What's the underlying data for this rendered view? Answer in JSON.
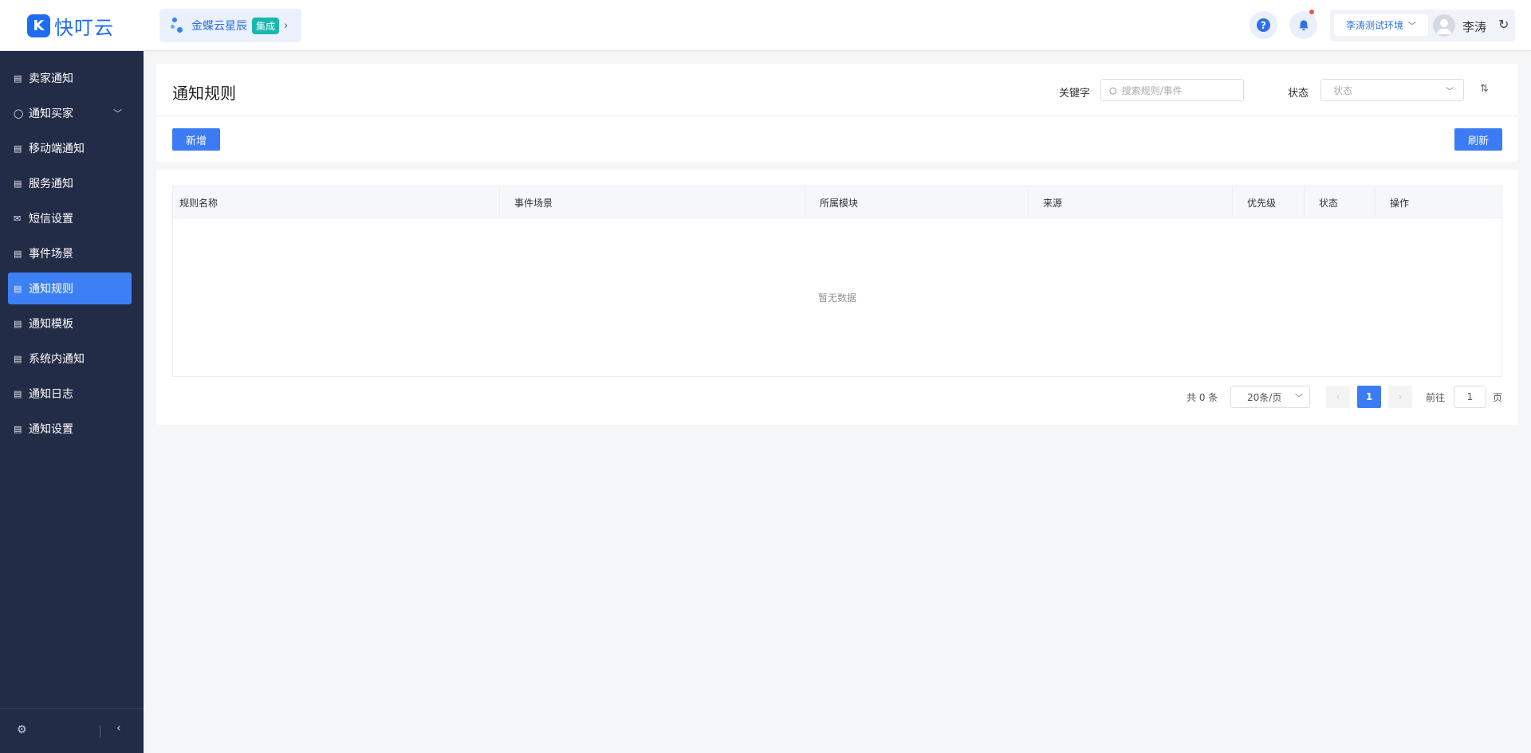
{
  "header": {
    "logo_mark": "K",
    "logo_text": "快叮云",
    "brand": {
      "name": "金蝶云星辰",
      "tag": "集成",
      "chevron": "›"
    },
    "help_glyph": "?",
    "env_label": "李涛测试环境",
    "user_name": "李涛",
    "accent_color": "#3b7cf5"
  },
  "sidebar": {
    "items": [
      {
        "label": "卖家通知",
        "icon": "doc-icon"
      },
      {
        "label": "通知买家",
        "icon": "chat-icon",
        "expandable": true
      },
      {
        "label": "移动端通知",
        "icon": "doc-icon"
      },
      {
        "label": "服务通知",
        "icon": "doc-icon"
      },
      {
        "label": "短信设置",
        "icon": "mail-icon"
      },
      {
        "label": "事件场景",
        "icon": "doc-icon"
      },
      {
        "label": "通知规则",
        "icon": "doc-icon",
        "active": true
      },
      {
        "label": "通知模板",
        "icon": "doc-icon"
      },
      {
        "label": "系统内通知",
        "icon": "doc-icon"
      },
      {
        "label": "通知日志",
        "icon": "doc-icon"
      },
      {
        "label": "通知设置",
        "icon": "doc-icon"
      }
    ]
  },
  "main": {
    "title": "通知规则",
    "filters": {
      "keyword_label": "关键字",
      "keyword_placeholder": "搜索规则/事件",
      "status_label": "状态",
      "status_placeholder": "状态"
    },
    "add_button": "新增",
    "refresh_button": "刷新",
    "table": {
      "columns": [
        "规则名称",
        "事件场景",
        "所属模块",
        "来源",
        "优先级",
        "状态",
        "操作"
      ],
      "rows": [],
      "empty_text": "暂无数据"
    },
    "pagination": {
      "total_text": "共 0 条",
      "page_size": "20条/页",
      "current_page": "1",
      "goto_label": "前往",
      "goto_value": "1",
      "goto_suffix": "页"
    }
  }
}
